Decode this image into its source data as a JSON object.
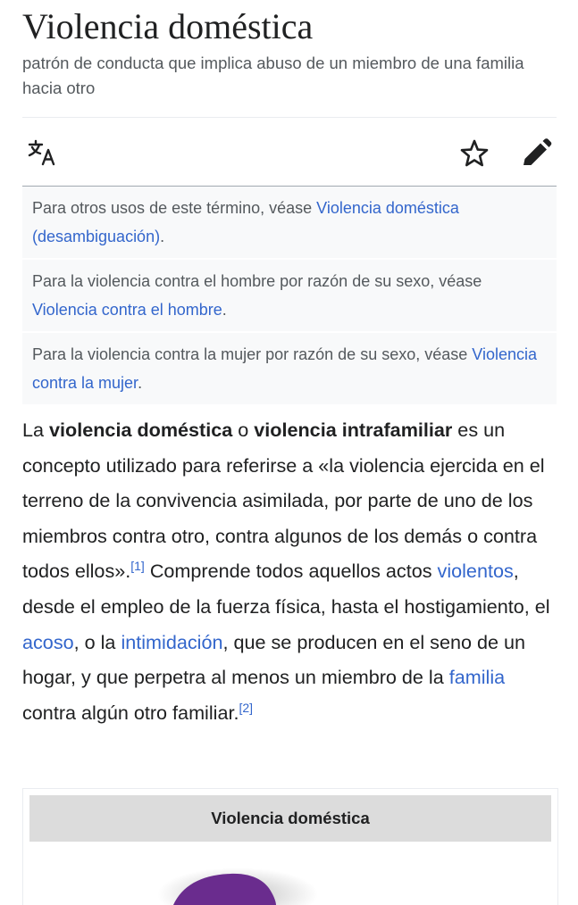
{
  "article": {
    "title": "Violencia doméstica",
    "subtitle": "patrón de conducta que implica abuso de un miembro de una familia hacia otro"
  },
  "toolbar": {
    "translate_icon": "translate-icon",
    "star_icon": "star-outline-icon",
    "edit_icon": "pencil-edit-icon"
  },
  "hatnotes": [
    {
      "text": "Para otros usos de este término, véase ",
      "link": "Violencia doméstica (desambiguación)",
      "end": "."
    },
    {
      "text": "Para la violencia contra el hombre por razón de su sexo, véase ",
      "link": "Violencia contra el hombre",
      "end": "."
    },
    {
      "text": "Para la violencia contra la mujer por razón de su sexo, véase ",
      "link": "Violencia contra la mujer",
      "end": "."
    }
  ],
  "intro": {
    "t1": "La ",
    "b1": "violencia doméstica",
    "t2": " o ",
    "b2": "violencia intrafamiliar",
    "t3": " es un concepto utilizado para referirse a «la violencia ejercida en el terreno de la convivencia asimilada, por parte de uno de los miembros contra otro, contra algunos de los demás o contra todos ellos».",
    "ref1": "[1]",
    "t4": "  Comprende todos aquellos actos ",
    "link1": "violentos",
    "t5": ", desde el empleo de la fuerza física, hasta el hostigamiento, el ",
    "link2": "acoso",
    "t6": ", o la ",
    "link3": "intimidación",
    "t7": ", que se producen en el seno de un hogar, y que perpetra al menos un miembro de la ",
    "link4": "familia",
    "t8": " contra algún otro familiar.",
    "ref2": "[2]"
  },
  "infobox": {
    "title": "Violencia doméstica",
    "image_color": "#6a2c8e"
  },
  "colors": {
    "link": "#3366cc",
    "text": "#202122",
    "muted": "#54595d",
    "hatnote_bg": "#f8f9fa",
    "infobox_head_bg": "#dcdcdc"
  }
}
